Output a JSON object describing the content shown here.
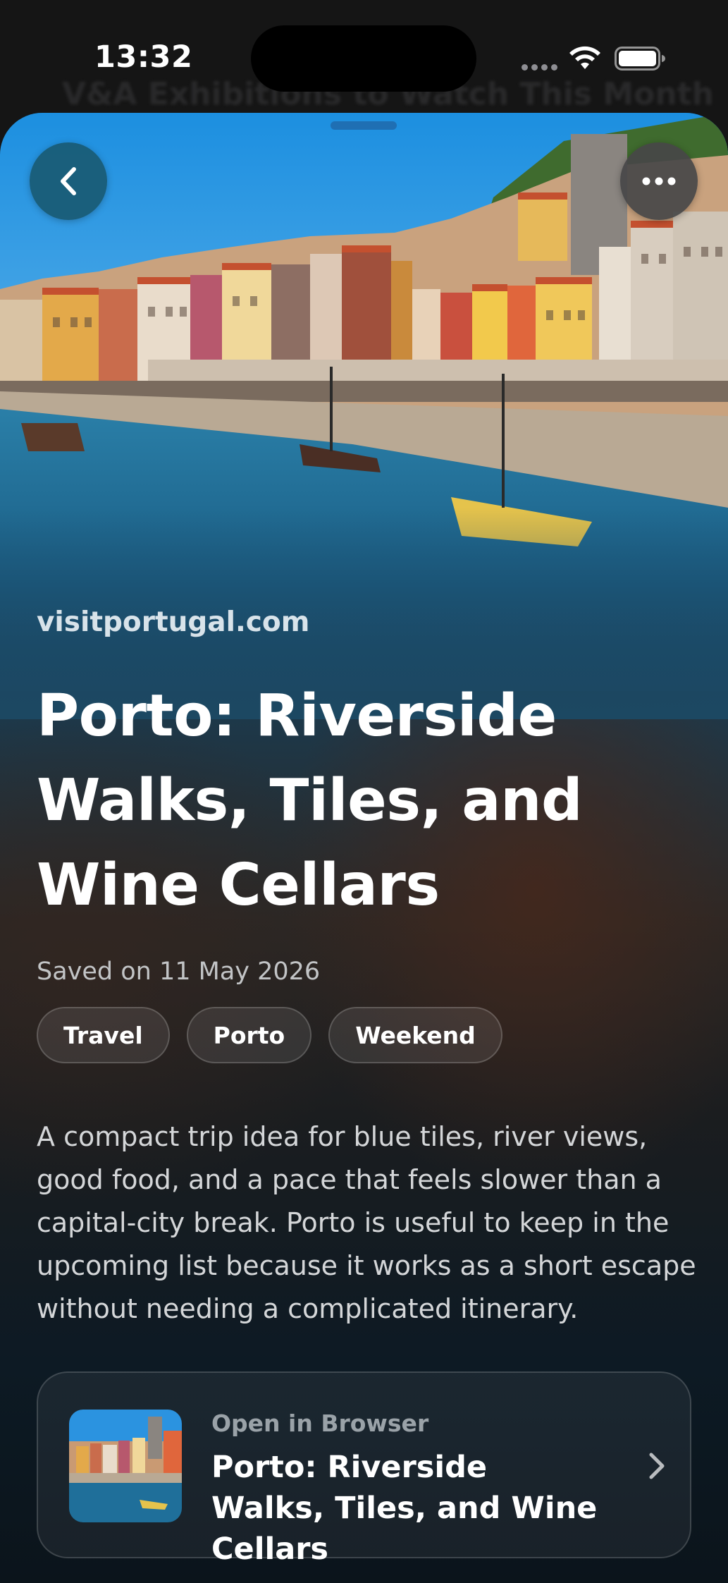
{
  "status_bar": {
    "time": "13:32"
  },
  "background_page": {
    "title": "V&A Exhibitions to Watch This Month"
  },
  "sheet": {
    "back_icon": "chevron-left-icon",
    "more_icon": "ellipsis-icon",
    "source": "visitportugal.com",
    "title": "Porto: Riverside Walks, Tiles, and Wine Cellars",
    "saved_date": "Saved on 11 May 2026",
    "tags": [
      "Travel",
      "Porto",
      "Weekend"
    ],
    "description": "A compact trip idea for blue tiles, river views, good food, and a pace that feels slower than a capital-city break. Porto is useful to keep in the upcoming list because it works as a short escape without needing a complicated itinerary.",
    "link_card": {
      "kicker": "Open in Browser",
      "title": "Porto: Riverside Walks, Tiles, and Wine Cellars",
      "icon": "chevron-right-icon"
    }
  },
  "colors": {
    "accent_blue": "#1f6fb3",
    "back_button": "#195a73",
    "text_primary": "#ffffff",
    "text_secondary": "#c2c4c6"
  }
}
